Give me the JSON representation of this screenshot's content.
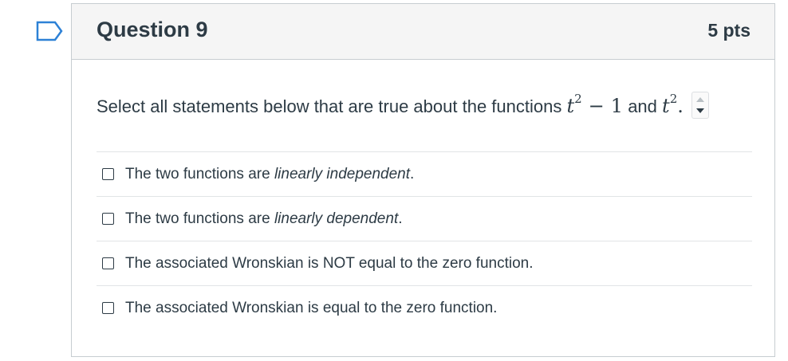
{
  "question": {
    "title": "Question 9",
    "points": "5 pts",
    "prompt_text": "Select all statements below that are true about the functions",
    "func1_base": "t",
    "func1_exp": "2",
    "func1_op": "−",
    "func1_const": "1",
    "conjunction": "and",
    "func2_base": "t",
    "func2_exp": "2",
    "end_punct": "."
  },
  "answers": [
    {
      "prefix": "The two functions are ",
      "emph": "linearly independent",
      "suffix": ".",
      "checked": false
    },
    {
      "prefix": "The two functions are ",
      "emph": "linearly dependent",
      "suffix": ".",
      "checked": false
    },
    {
      "prefix": "The associated Wronskian is NOT equal to the zero function.",
      "emph": "",
      "suffix": "",
      "checked": false
    },
    {
      "prefix": "The associated Wronskian is equal to the zero function.",
      "emph": "",
      "suffix": "",
      "checked": false
    }
  ],
  "icons": {
    "bookmark": "bookmark-icon",
    "spinner": "math-spinner-icon"
  },
  "colors": {
    "accent": "#2d81d6",
    "text": "#2d3b45",
    "header_bg": "#f5f5f5",
    "border": "#c7cdd1"
  }
}
